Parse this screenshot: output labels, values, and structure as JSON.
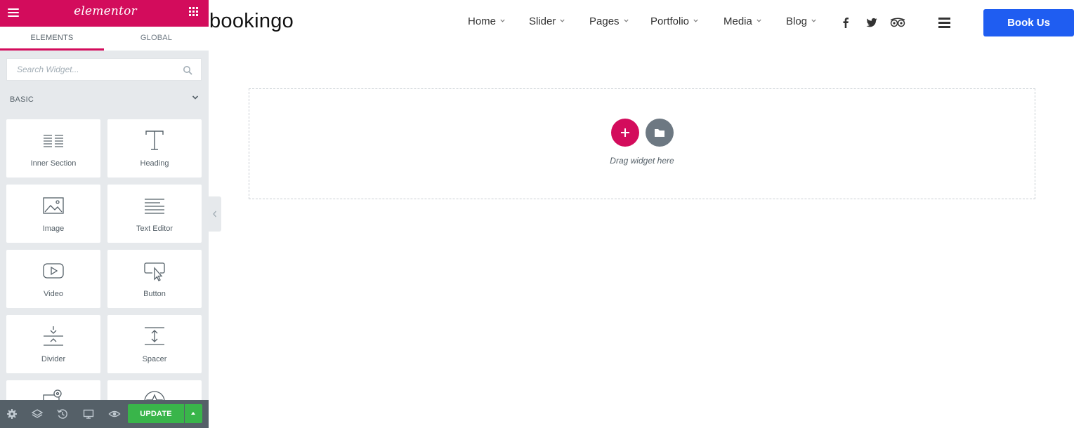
{
  "panel": {
    "logo_text": "elementor",
    "tabs": [
      "ELEMENTS",
      "GLOBAL"
    ],
    "search": {
      "placeholder": "Search Widget...",
      "value": ""
    },
    "category": "BASIC",
    "widgets": [
      {
        "label": "Inner Section",
        "icon": "inner-section-icon"
      },
      {
        "label": "Heading",
        "icon": "heading-icon"
      },
      {
        "label": "Image",
        "icon": "image-icon"
      },
      {
        "label": "Text Editor",
        "icon": "text-editor-icon"
      },
      {
        "label": "Video",
        "icon": "video-icon"
      },
      {
        "label": "Button",
        "icon": "button-icon"
      },
      {
        "label": "Divider",
        "icon": "divider-icon"
      },
      {
        "label": "Spacer",
        "icon": "spacer-icon"
      },
      {
        "label": "",
        "icon": "google-maps-icon"
      },
      {
        "label": "",
        "icon": "icon-widget-icon"
      }
    ],
    "footer": {
      "update_label": "UPDATE"
    }
  },
  "site": {
    "logo": "bookingo",
    "nav": [
      "Home",
      "Slider",
      "Pages",
      "Portfolio",
      "Media",
      "Blog"
    ],
    "social": [
      "facebook-icon",
      "twitter-icon",
      "tripadvisor-icon"
    ],
    "book_label": "Book Us"
  },
  "canvas": {
    "drop_text": "Drag widget here"
  },
  "colors": {
    "accent": "#d30c5c",
    "update": "#39b54a",
    "book": "#1f5df1"
  }
}
